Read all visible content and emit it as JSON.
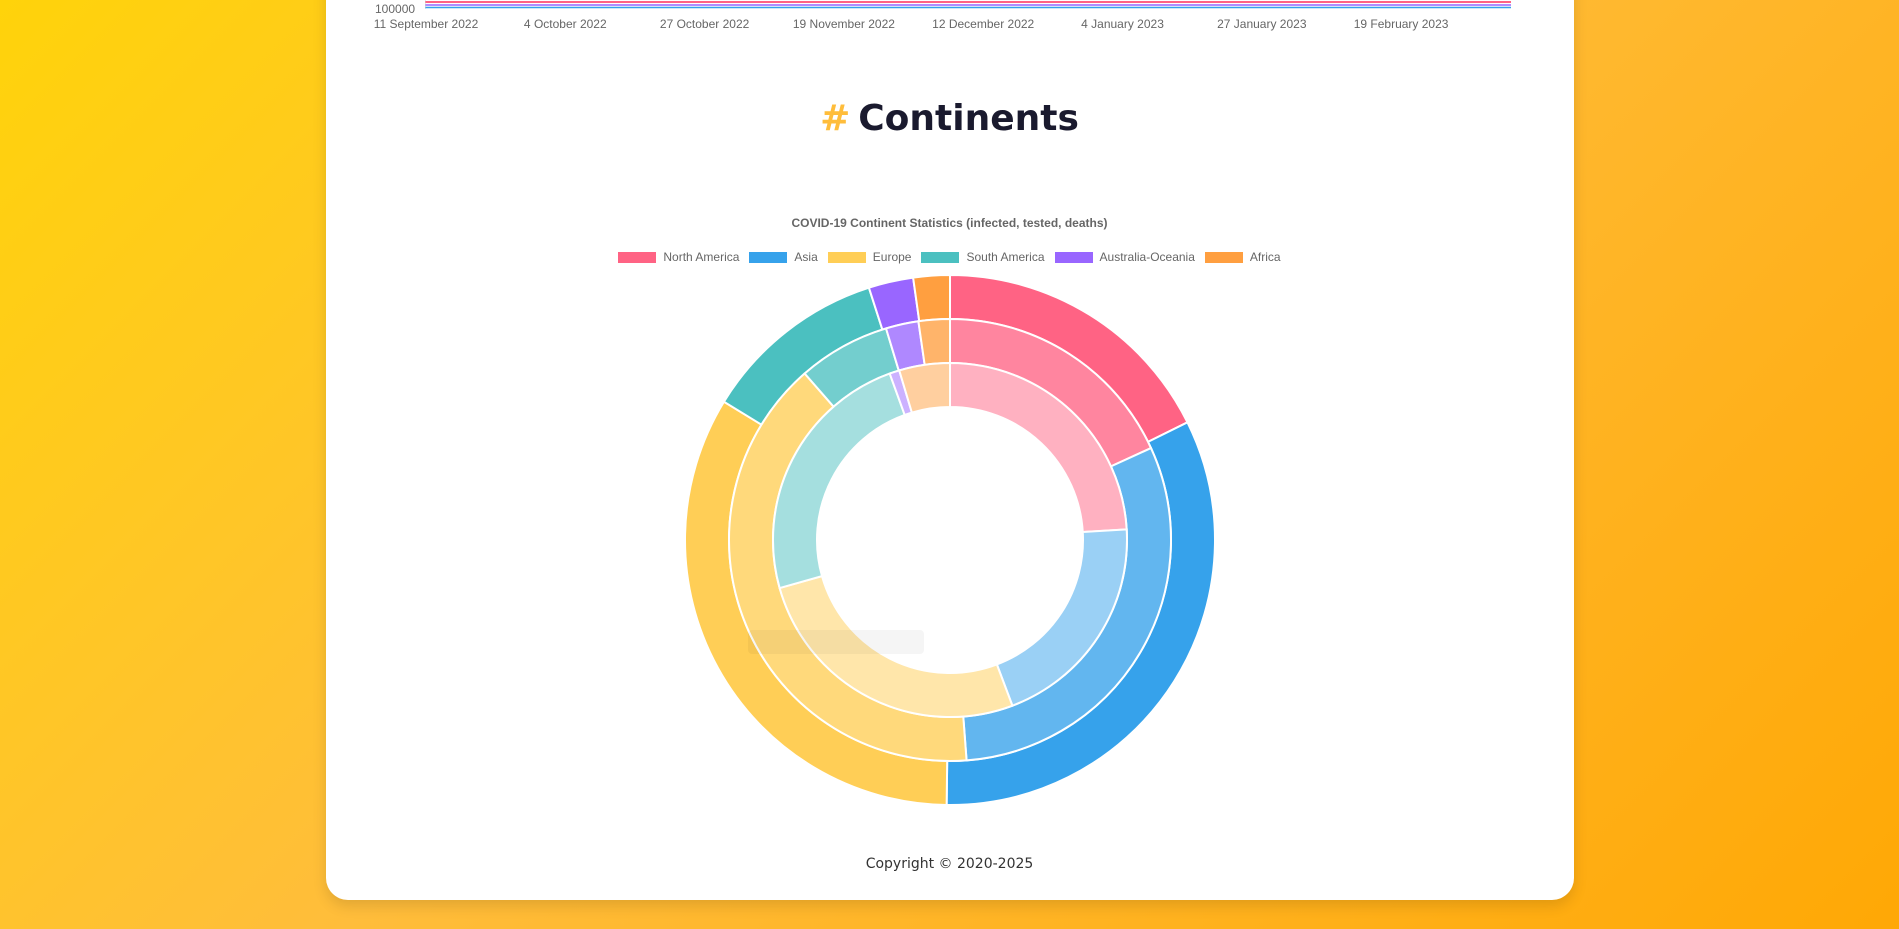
{
  "timeline": {
    "y_tick": "100000",
    "x_ticks": [
      "11 September 2022",
      "4 October 2022",
      "27 October 2022",
      "19 November 2022",
      "12 December 2022",
      "4 January 2023",
      "27 January 2023",
      "19 February 2023"
    ]
  },
  "section": {
    "hash": "#",
    "title": "Continents"
  },
  "footer": {
    "copyright": "Copyright © 2020-2025"
  },
  "chart_data": {
    "type": "doughnut",
    "title": "COVID-19 Continent Statistics (infected, tested, deaths)",
    "legend_position": "top",
    "categories": [
      "North America",
      "Asia",
      "Europe",
      "South America",
      "Australia-Oceania",
      "Africa"
    ],
    "colors": [
      "#ff6384",
      "#36a2eb",
      "#ffce56",
      "#4bc0c0",
      "#9966ff",
      "#ff9f40"
    ],
    "series": [
      {
        "ring": "outer",
        "values": [
          17.5,
          32.2,
          33.2,
          11.2,
          2.7,
          2.2
        ]
      },
      {
        "ring": "middle",
        "values": [
          17.5,
          29.5,
          38.3,
          6.5,
          2.3,
          2.2
        ]
      },
      {
        "ring": "inner",
        "values": [
          23.9,
          20.1,
          26.2,
          23.7,
          0.9,
          4.6
        ]
      }
    ]
  }
}
